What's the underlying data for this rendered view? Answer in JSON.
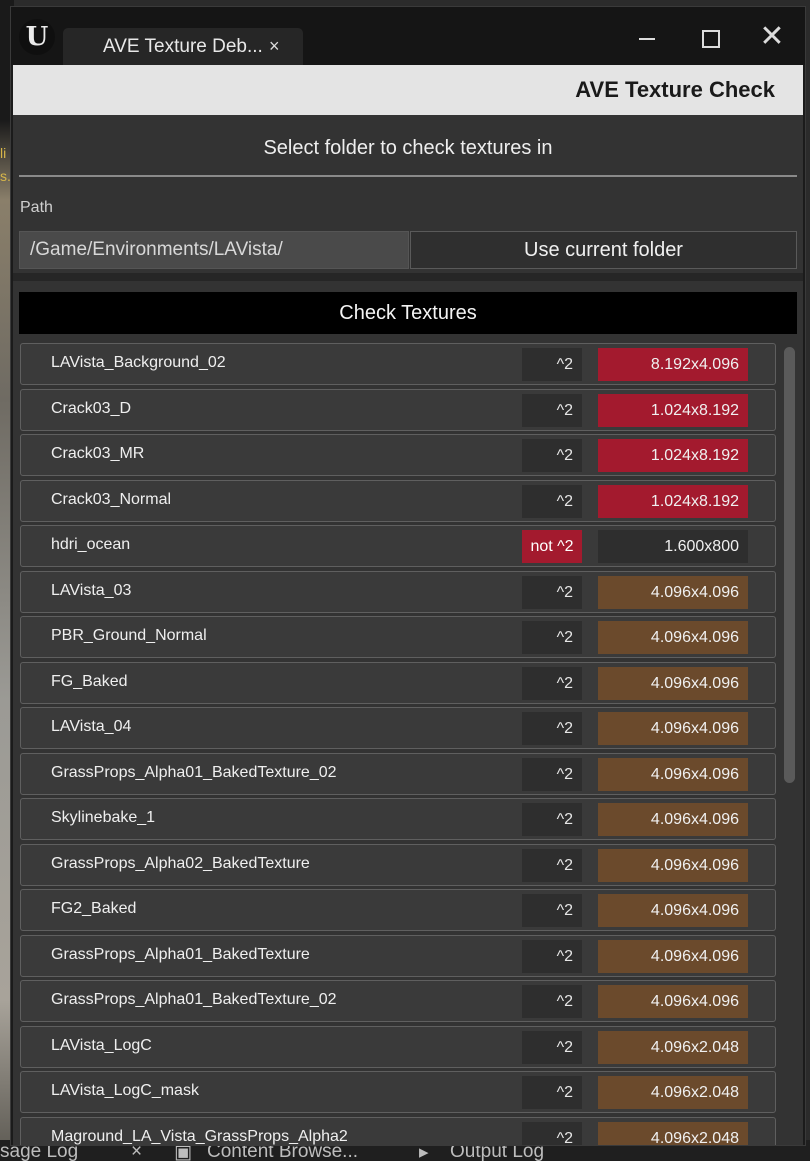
{
  "window": {
    "tab_title": "AVE Texture Deb...",
    "close_glyph": "×"
  },
  "header": {
    "title": "AVE Texture Check"
  },
  "folder": {
    "heading": "Select folder to check textures in",
    "path_label": "Path",
    "path_value": "/Game/Environments/LAVista/",
    "use_current_label": "Use current folder"
  },
  "check_button_label": "Check Textures",
  "textures": [
    {
      "name": "LAVista_Background_02",
      "pow2": "^2",
      "pow2_ok": true,
      "resolution": "8.192x4.096",
      "res_status": "red"
    },
    {
      "name": "Crack03_D",
      "pow2": "^2",
      "pow2_ok": true,
      "resolution": "1.024x8.192",
      "res_status": "red"
    },
    {
      "name": "Crack03_MR",
      "pow2": "^2",
      "pow2_ok": true,
      "resolution": "1.024x8.192",
      "res_status": "red"
    },
    {
      "name": "Crack03_Normal",
      "pow2": "^2",
      "pow2_ok": true,
      "resolution": "1.024x8.192",
      "res_status": "red"
    },
    {
      "name": "hdri_ocean",
      "pow2": "not ^2",
      "pow2_ok": false,
      "resolution": "1.600x800",
      "res_status": "none"
    },
    {
      "name": "LAVista_03",
      "pow2": "^2",
      "pow2_ok": true,
      "resolution": "4.096x4.096",
      "res_status": "brown"
    },
    {
      "name": "PBR_Ground_Normal",
      "pow2": "^2",
      "pow2_ok": true,
      "resolution": "4.096x4.096",
      "res_status": "brown"
    },
    {
      "name": "FG_Baked",
      "pow2": "^2",
      "pow2_ok": true,
      "resolution": "4.096x4.096",
      "res_status": "brown"
    },
    {
      "name": "LAVista_04",
      "pow2": "^2",
      "pow2_ok": true,
      "resolution": "4.096x4.096",
      "res_status": "brown"
    },
    {
      "name": "GrassProps_Alpha01_BakedTexture_02",
      "pow2": "^2",
      "pow2_ok": true,
      "resolution": "4.096x4.096",
      "res_status": "brown"
    },
    {
      "name": "Skylinebake_1",
      "pow2": "^2",
      "pow2_ok": true,
      "resolution": "4.096x4.096",
      "res_status": "brown"
    },
    {
      "name": "GrassProps_Alpha02_BakedTexture",
      "pow2": "^2",
      "pow2_ok": true,
      "resolution": "4.096x4.096",
      "res_status": "brown"
    },
    {
      "name": "FG2_Baked",
      "pow2": "^2",
      "pow2_ok": true,
      "resolution": "4.096x4.096",
      "res_status": "brown"
    },
    {
      "name": "GrassProps_Alpha01_BakedTexture",
      "pow2": "^2",
      "pow2_ok": true,
      "resolution": "4.096x4.096",
      "res_status": "brown"
    },
    {
      "name": "GrassProps_Alpha01_BakedTexture_02",
      "pow2": "^2",
      "pow2_ok": true,
      "resolution": "4.096x4.096",
      "res_status": "brown"
    },
    {
      "name": "LAVista_LogC",
      "pow2": "^2",
      "pow2_ok": true,
      "resolution": "4.096x2.048",
      "res_status": "brown"
    },
    {
      "name": "LAVista_LogC_mask",
      "pow2": "^2",
      "pow2_ok": true,
      "resolution": "4.096x2.048",
      "res_status": "brown"
    },
    {
      "name": "Maground_LA_Vista_GrassProps_Alpha2",
      "pow2": "^2",
      "pow2_ok": true,
      "resolution": "4.096x2.048",
      "res_status": "brown"
    }
  ],
  "bottom_tabs": {
    "message_log": "sage Log",
    "message_log_close": "×",
    "content_browser": "Content Browse...",
    "output_log": "Output Log"
  },
  "colors": {
    "red_status": "#a31a2e",
    "brown_status": "#6b4a2c"
  }
}
